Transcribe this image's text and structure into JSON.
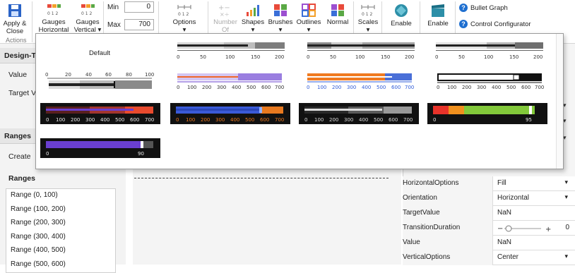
{
  "ribbon": {
    "apply_close": "Apply & Close",
    "actions_group": "Actions",
    "gauges_horizontal": "Gauges Horizontal",
    "gauges_vertical": "Gauges Vertical",
    "min_label": "Min",
    "min_value": "0",
    "max_label": "Max",
    "max_value": "700",
    "options": "Options",
    "number_of": "Number Of",
    "shapes": "Shapes",
    "brushes": "Brushes",
    "outlines": "Outlines",
    "normal": "Normal",
    "scales": "Scales",
    "enable1": "Enable",
    "enable2": "Enable",
    "bullet_graph": "Bullet Graph",
    "control_configurator": "Control Configurator"
  },
  "left": {
    "design_header": "Design-Ti",
    "value_label": "Value",
    "target_label": "Target Va",
    "ranges_header": "Ranges",
    "create_label": "Create",
    "ranges_label": "Ranges",
    "ranges": [
      "Range (0, 100)",
      "Range (100, 200)",
      "Range (200, 300)",
      "Range (300, 400)",
      "Range (400, 500)",
      "Range (500, 600)"
    ]
  },
  "properties": [
    {
      "name": "HorizontalOptions",
      "value": "Fill",
      "dropdown": true
    },
    {
      "name": "Orientation",
      "value": "Horizontal",
      "dropdown": true
    },
    {
      "name": "TargetValue",
      "value": "NaN",
      "dropdown": false
    },
    {
      "name": "TransitionDuration",
      "value": "0",
      "dropdown": false
    },
    {
      "name": "Value",
      "value": "NaN",
      "dropdown": false
    },
    {
      "name": "VerticalOptions",
      "value": "Center",
      "dropdown": true
    }
  ],
  "gallery": {
    "default_label": "Default",
    "scale_200": [
      "0",
      "50",
      "100",
      "150",
      "200"
    ],
    "scale_100": [
      "0",
      "20",
      "40",
      "60",
      "80",
      "100"
    ],
    "scale_700": [
      "0",
      "100",
      "200",
      "300",
      "400",
      "500",
      "600",
      "700"
    ],
    "label_95": "95",
    "label_90": "90",
    "label_0": "0",
    "colors": {
      "purple": "#6a3fd0",
      "orange": "#f07a20",
      "blue": "#2e5bd8",
      "green": "#7cc42e",
      "red": "#e83a2e"
    }
  }
}
